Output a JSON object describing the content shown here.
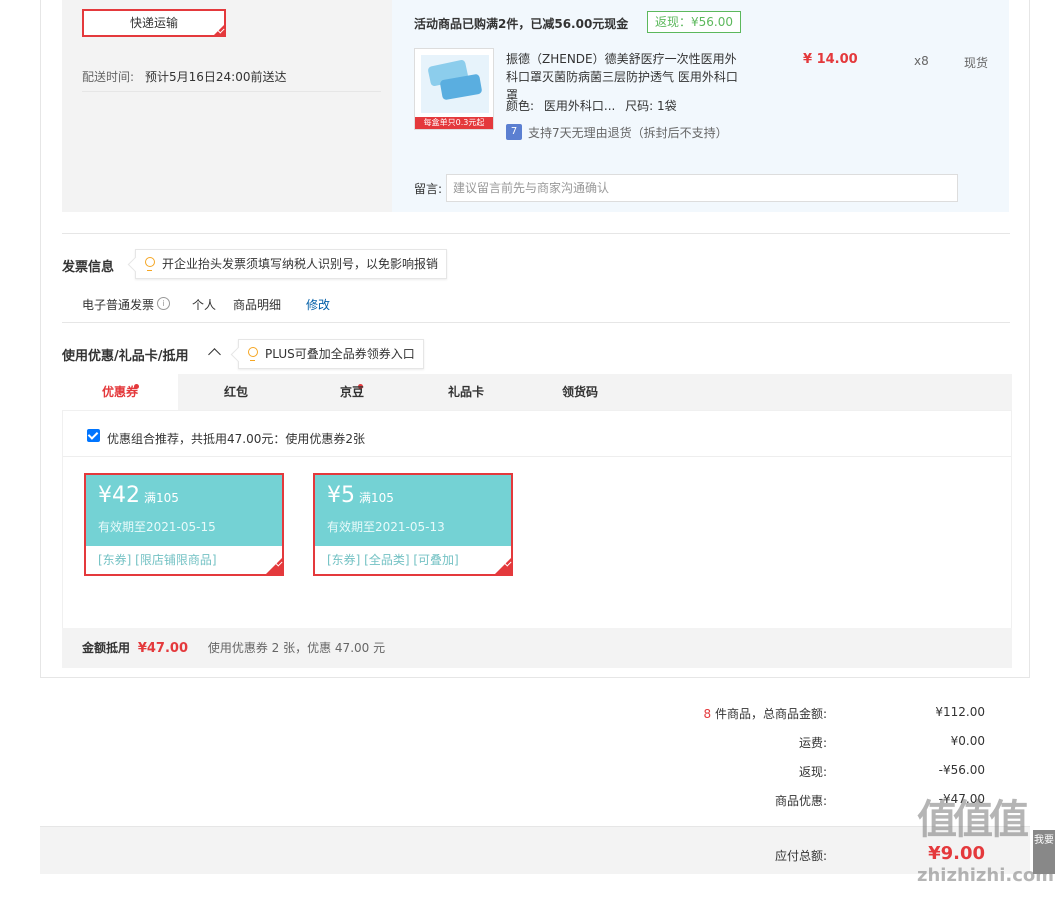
{
  "shipping": {
    "express_label": "快递运输",
    "delivery_label": "配送时间:",
    "delivery_value": "预计5月16日24:00前送达"
  },
  "promo": {
    "text": "活动商品已购满2件，已减56.00元现金",
    "badge": "返现：¥56.00"
  },
  "product": {
    "image_caption": "每盒单只0.3元起",
    "title": "振德（ZHENDE）德美舒医疗一次性医用外科口罩灭菌防病菌三层防护透气 医用外科口罩",
    "price": "¥ 14.00",
    "qty": "x8",
    "stock": "现货",
    "color_label": "颜色:",
    "color_value": "医用外科口...",
    "size_label": "尺码:",
    "size_value": "1袋",
    "return_icon": "7",
    "return_text": "支持7天无理由退货（拆封后不支持）"
  },
  "message": {
    "label": "留言:",
    "placeholder": "建议留言前先与商家沟通确认"
  },
  "invoice": {
    "title": "发票信息",
    "tip": "开企业抬头发票须填写纳税人识别号，以免影响报销",
    "type": "电子普通发票",
    "info_icon": "i",
    "person": "个人",
    "detail": "商品明细",
    "edit": "修改"
  },
  "discount": {
    "title": "使用优惠/礼品卡/抵用",
    "tip": "PLUS可叠加全品券领券入口",
    "tabs": [
      {
        "label": "优惠券"
      },
      {
        "label": "红包"
      },
      {
        "label": "京豆"
      },
      {
        "label": "礼品卡"
      },
      {
        "label": "领货码"
      }
    ],
    "combo_text": "优惠组合推荐，共抵用47.00元：使用优惠券2张",
    "coupons": [
      {
        "amount": "¥42",
        "cond": "满105",
        "expiry": "有效期至2021-05-15",
        "tags": "[东券]  [限店铺限商品]"
      },
      {
        "amount": "¥5",
        "cond": "满105",
        "expiry": "有效期至2021-05-13",
        "tags": "[东券]  [全品类]  [可叠加]"
      }
    ],
    "sum_label": "金额抵用",
    "sum_value": "¥47.00",
    "sum_desc": "使用优惠券 2 张，优惠 47.00 元"
  },
  "totals": {
    "count": "8",
    "count_suffix": "件商品，总商品金额:",
    "goods_total": "¥112.00",
    "freight_label": "运费:",
    "freight": "¥0.00",
    "cashback_label": "返现:",
    "cashback": "-¥56.00",
    "discount_label": "商品优惠:",
    "discount": "-¥47.00",
    "payable_label": "应付总额:",
    "payable": "¥9.00"
  },
  "watermark": {
    "main": "值值值",
    "sub": "zhizhizhi.com"
  },
  "side_tab": "我要"
}
